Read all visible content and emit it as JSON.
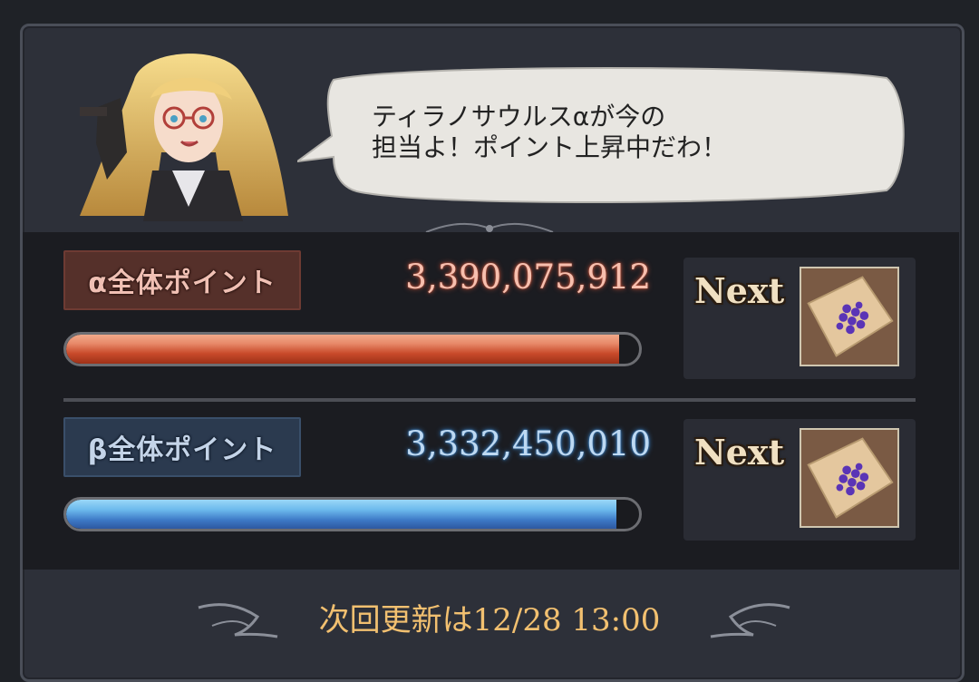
{
  "speech": {
    "text": "ティラノサウルスαが今の\n担当よ！ポイント上昇中だわ！"
  },
  "alpha": {
    "label": "α全体ポイント",
    "value": "3,390,075,912",
    "progress": 0.965,
    "next_label": "Next",
    "next_item_icon": "berries-on-cloth-icon",
    "color": "#e88a6a"
  },
  "beta": {
    "label": "β全体ポイント",
    "value": "3,332,450,010",
    "progress": 0.96,
    "next_label": "Next",
    "next_item_icon": "berries-on-cloth-icon",
    "color": "#6cb9ec"
  },
  "footer": {
    "update_text": "次回更新は12/28 13:00"
  },
  "character": {
    "icon": "blonde-glasses-character-portrait"
  }
}
